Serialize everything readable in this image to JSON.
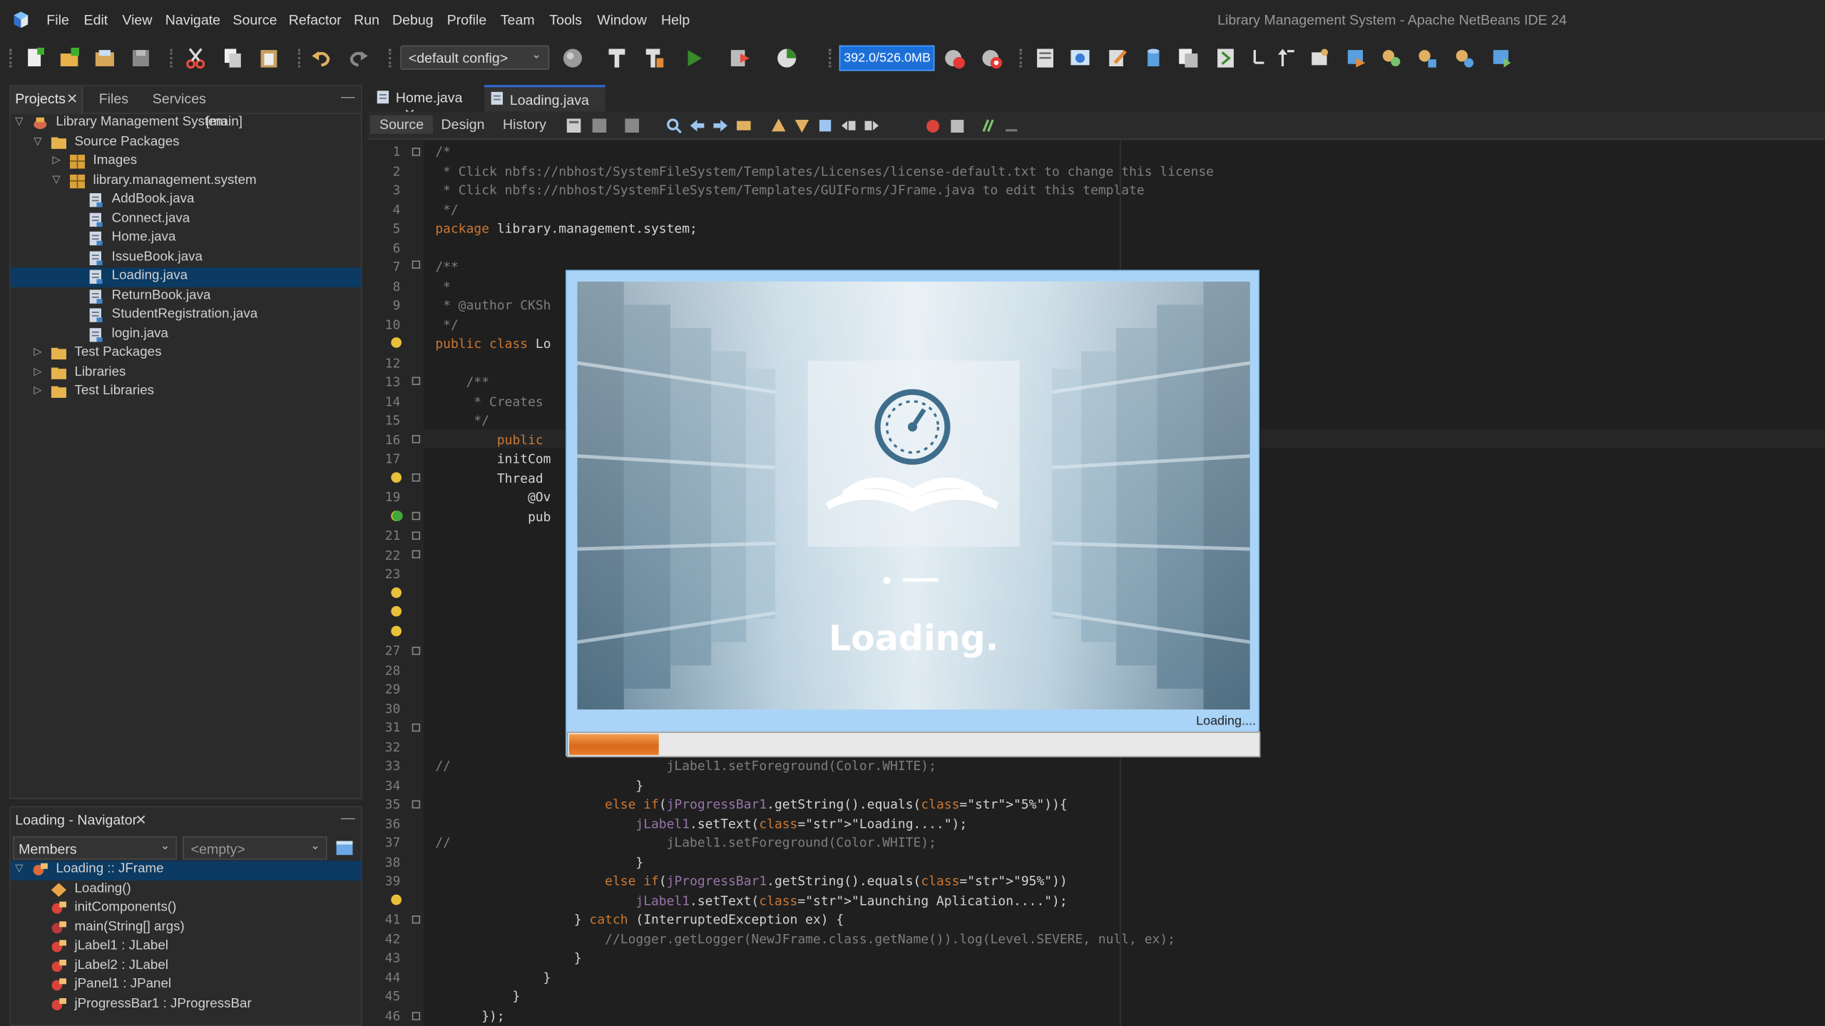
{
  "window_title": "Library Management System - Apache NetBeans IDE 24",
  "menu": [
    "File",
    "Edit",
    "View",
    "Navigate",
    "Source",
    "Refactor",
    "Run",
    "Debug",
    "Profile",
    "Team",
    "Tools",
    "Window",
    "Help"
  ],
  "toolbar": {
    "config": "<default config>",
    "memory": "392.0/526.0MB"
  },
  "projects": {
    "tabs": [
      "Projects",
      "Files",
      "Services"
    ],
    "tree": [
      {
        "label": "Library Management System",
        "suffix": "[main]",
        "icon": "project-icon",
        "expanded": true
      },
      {
        "label": "Source Packages",
        "icon": "folder-icon",
        "expanded": true
      },
      {
        "label": "Images",
        "icon": "package-icon",
        "expanded": false
      },
      {
        "label": "library.management.system",
        "icon": "package-icon",
        "expanded": true
      },
      {
        "label": "AddBook.java",
        "icon": "java-file-icon"
      },
      {
        "label": "Connect.java",
        "icon": "java-file-icon"
      },
      {
        "label": "Home.java",
        "icon": "java-file-icon"
      },
      {
        "label": "IssueBook.java",
        "icon": "java-file-icon"
      },
      {
        "label": "Loading.java",
        "icon": "java-file-icon",
        "selected": true
      },
      {
        "label": "ReturnBook.java",
        "icon": "java-file-icon"
      },
      {
        "label": "StudentRegistration.java",
        "icon": "java-file-icon"
      },
      {
        "label": "login.java",
        "icon": "java-file-icon"
      },
      {
        "label": "Test Packages",
        "icon": "folder-icon",
        "expanded": false
      },
      {
        "label": "Libraries",
        "icon": "folder-icon",
        "expanded": false
      },
      {
        "label": "Test Libraries",
        "icon": "folder-icon",
        "expanded": false
      }
    ]
  },
  "navigator": {
    "title": "Loading - Navigator",
    "filter": "Members",
    "scope": "<empty>",
    "items": [
      {
        "label": "Loading :: JFrame",
        "icon": "class-icon",
        "selected": true
      },
      {
        "label": "Loading()",
        "icon": "constructor-icon"
      },
      {
        "label": "initComponents()",
        "icon": "private-method-icon"
      },
      {
        "label": "main(String[] args)",
        "icon": "static-method-icon"
      },
      {
        "label": "jLabel1 : JLabel",
        "icon": "field-icon"
      },
      {
        "label": "jLabel2 : JLabel",
        "icon": "field-icon"
      },
      {
        "label": "jPanel1 : JPanel",
        "icon": "field-icon"
      },
      {
        "label": "jProgressBar1 : JProgressBar",
        "icon": "field-icon"
      }
    ]
  },
  "editor": {
    "tabs": [
      "Home.java",
      "Loading.java"
    ],
    "active_tab": "Loading.java",
    "modes": [
      "Source",
      "Design",
      "History"
    ],
    "lines": [
      {
        "n": "1",
        "code": "/*"
      },
      {
        "n": "2",
        "code": " * Click nbfs://nbhost/SystemFileSystem/Templates/Licenses/license-default.txt to change this license"
      },
      {
        "n": "3",
        "code": " * Click nbfs://nbhost/SystemFileSystem/Templates/GUIForms/JFrame.java to edit this template"
      },
      {
        "n": "4",
        "code": " */"
      },
      {
        "n": "5",
        "code": "package library.management.system;"
      },
      {
        "n": "6",
        "code": ""
      },
      {
        "n": "7",
        "code": "/**"
      },
      {
        "n": "8",
        "code": " *"
      },
      {
        "n": "9",
        "code": " * @author CKSh"
      },
      {
        "n": "10",
        "code": " */"
      },
      {
        "n": "",
        "code": "public class Lo"
      },
      {
        "n": "12",
        "code": ""
      },
      {
        "n": "13",
        "code": "    /**"
      },
      {
        "n": "14",
        "code": "     * Creates"
      },
      {
        "n": "15",
        "code": "     */"
      },
      {
        "n": "16",
        "code": "        public"
      },
      {
        "n": "17",
        "code": "        initCom"
      },
      {
        "n": "",
        "code": "        Thread"
      },
      {
        "n": "19",
        "code": "            @Ov"
      },
      {
        "n": "",
        "code": "            pub"
      },
      {
        "n": "21",
        "code": ""
      },
      {
        "n": "22",
        "code": ""
      },
      {
        "n": "23",
        "code": ""
      },
      {
        "n": "",
        "code": ""
      },
      {
        "n": "",
        "code": ""
      },
      {
        "n": "",
        "code": ""
      },
      {
        "n": "27",
        "code": ""
      },
      {
        "n": "28",
        "code": ""
      },
      {
        "n": "29",
        "code": ""
      },
      {
        "n": "30",
        "code": ""
      },
      {
        "n": "31",
        "code": ""
      },
      {
        "n": "32",
        "code": ""
      },
      {
        "n": "33",
        "code": "//                            jLabel1.setForeground(Color.WHITE);"
      },
      {
        "n": "34",
        "code": "                          }"
      },
      {
        "n": "35",
        "code": "                      else if(jProgressBar1.getString().equals(\"5%\")){"
      },
      {
        "n": "36",
        "code": "                          jLabel1.setText(\"Loading....\");"
      },
      {
        "n": "37",
        "code": "//                            jLabel1.setForeground(Color.WHITE);"
      },
      {
        "n": "38",
        "code": "                          }"
      },
      {
        "n": "39",
        "code": "                      else if(jProgressBar1.getString().equals(\"95%\"))"
      },
      {
        "n": "",
        "code": "                          jLabel1.setText(\"Launching Aplication....\");"
      },
      {
        "n": "41",
        "code": "                  } catch (InterruptedException ex) {"
      },
      {
        "n": "42",
        "code": "                      //Logger.getLogger(NewJFrame.class.getName()).log(Level.SEVERE, null, ex);"
      },
      {
        "n": "43",
        "code": "                  }"
      },
      {
        "n": "44",
        "code": "              }"
      },
      {
        "n": "45",
        "code": "          }"
      },
      {
        "n": "46",
        "code": "      });"
      }
    ]
  },
  "dialog": {
    "splash_text": "Loading.",
    "status_text": "Loading....",
    "progress": 0.13
  }
}
